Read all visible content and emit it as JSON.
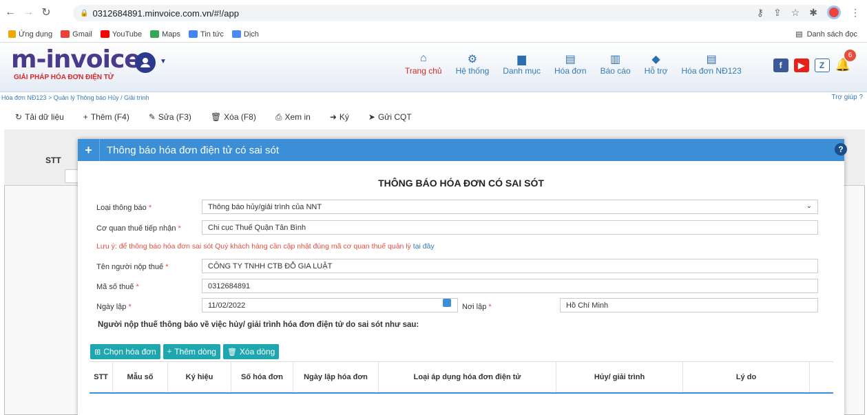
{
  "browser": {
    "url": "0312684891.minvoice.com.vn/#!/app",
    "bookmarks": [
      "Ứng dụng",
      "Gmail",
      "YouTube",
      "Maps",
      "Tin tức",
      "Dịch"
    ],
    "reading_list": "Danh sách đọc"
  },
  "app": {
    "logo_main": "m-invoice",
    "logo_sub": "GIẢI PHÁP HÓA ĐƠN ĐIỆN TỬ",
    "menu": [
      "Trang chủ",
      "Hệ thống",
      "Danh mục",
      "Hóa đơn",
      "Báo cáo",
      "Hỗ trợ",
      "Hóa đơn NĐ123"
    ],
    "notification_count": "6",
    "breadcrumb": "Hóa đơn NĐ123 > Quản lý Thông báo Hủy / Giải trình",
    "help_link": "Trợ giúp"
  },
  "toolbar": {
    "reload": "Tải dữ liệu",
    "add": "Thêm (F4)",
    "edit": "Sửa (F3)",
    "delete": "Xóa (F8)",
    "print": "Xem in",
    "sign": "Ký",
    "send": "Gửi CQT"
  },
  "grid": {
    "stt": "STT"
  },
  "modal": {
    "header_title": "Thông báo hóa đơn điện tử có sai sót",
    "form_title": "THÔNG BÁO HÓA ĐƠN CÓ SAI SÓT",
    "notice_type_label": "Loại thông báo",
    "notice_type_value": "Thông báo hủy/giải trình của NNT",
    "tax_office_label": "Cơ quan thuế tiếp nhận",
    "tax_office_value": "Chi cục Thuế Quận Tân Bình",
    "note_text": "Lưu ý: để thông báo hóa đơn sai sót Quý khách hàng cần cập nhật đúng mã cơ quan thuế quản lý",
    "note_link": "tại đây",
    "taxpayer_label": "Tên người nộp thuế",
    "taxpayer_value": "CÔNG TY TNHH CTB ĐỖ GIA LUẬT",
    "tax_code_label": "Mã số thuế",
    "tax_code_value": "0312684891",
    "date_label": "Ngày lập",
    "date_value": "11/02/2022",
    "place_label": "Nơi lập",
    "place_value": "Hồ Chí Minh",
    "section_text": "Người nộp thuế thông báo về việc hủy/ giải trình hóa đơn điện tử do sai sót như sau:",
    "btn_choose": "Chọn hóa đơn",
    "btn_add_row": "Thêm dòng",
    "btn_delete_row": "Xóa dòng",
    "columns": [
      "STT",
      "Mẫu số",
      "Ký hiệu",
      "Số hóa đơn",
      "Ngày lập hóa đơn",
      "Loại áp dụng hóa đơn điện tử",
      "Hủy/ giải trình",
      "Lý do"
    ]
  }
}
